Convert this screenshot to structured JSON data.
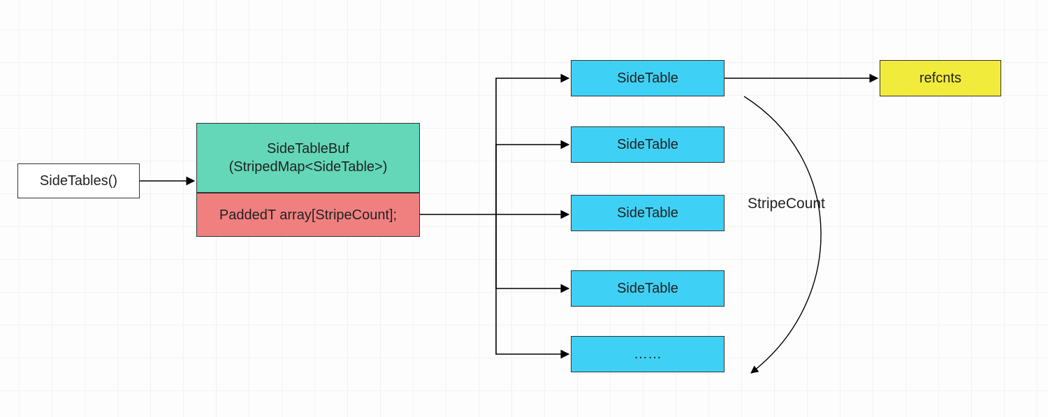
{
  "nodes": {
    "sidetables_fn": "SideTables()",
    "buf_line1": "SideTableBuf",
    "buf_line2": "(StripedMap<SideTable>)",
    "array_decl": "PaddedT array[StripeCount];",
    "st1": "SideTable",
    "st2": "SideTable",
    "st3": "SideTable",
    "st4": "SideTable",
    "st5": "……",
    "refcnts": "refcnts"
  },
  "labels": {
    "stripecount": "StripeCount"
  }
}
